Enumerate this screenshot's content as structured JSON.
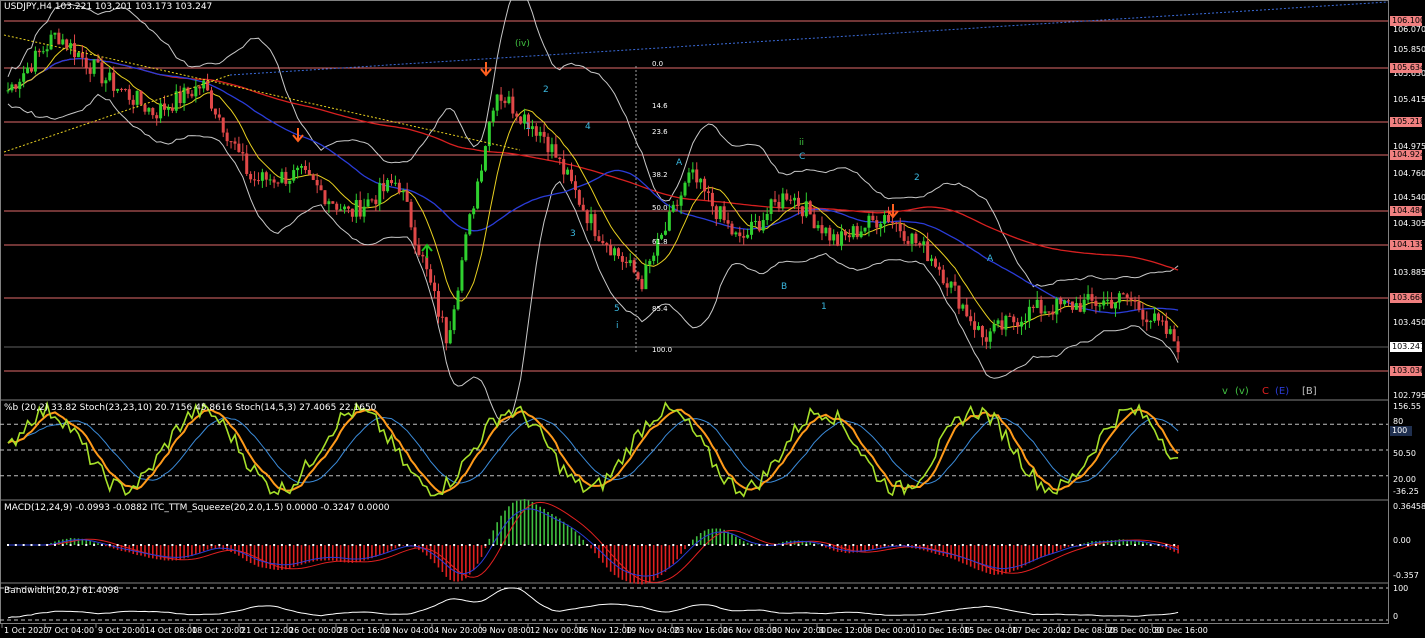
{
  "window": {
    "symbol_line": "USDJPY,H4  103.221 103.201 103.173 103.247",
    "panel2_title": "%b (20,2) 33.82  Stoch(23,23,10) 20.7156 45.8616  Stoch(14,5,3) 27.4065 22.1650",
    "panel3_title": "MACD(12,24,9) -0.0993 -0.0882  ITC_TTM_Squeeze(20,2.0,1.5) 0.0000 -0.3247 0.0000",
    "panel4_title": "Bandwidth(20,2) 61.4098"
  },
  "colors": {
    "background": "#000000",
    "bull": "#2fd02f",
    "bear": "#e04848",
    "level_line": "#e06a6a",
    "level_box": "#f08080",
    "ma_red": "#d82020",
    "ma_blue": "#2a3cd8",
    "ma_yellow": "#e8d020",
    "bands": "#c8c8c8",
    "stoch_green": "#a6e02a",
    "stoch_orange": "#ff9a1a",
    "stoch_blue": "#3a8ad8",
    "macd_green": "#40c040",
    "macd_red": "#e02020",
    "arrow_orange": "#ff6020",
    "arrow_green": "#20c020"
  },
  "price_axis": {
    "ticks": [
      "106.070",
      "105.850",
      "105.630",
      "105.415",
      "104.975",
      "104.760",
      "104.540",
      "104.305",
      "103.885",
      "103.450",
      "102.795"
    ],
    "boxed_levels": [
      "106.100",
      "105.634",
      "105.218",
      "104.924",
      "104.486",
      "104.135",
      "103.668",
      "103.247",
      "103.036"
    ],
    "current": "103.247"
  },
  "panel2_axis": [
    "156.55",
    "80",
    "50.50",
    "20.00",
    "-36.25"
  ],
  "panel2_box": "100",
  "panel3_axis": [
    "0.36458",
    "0.00",
    "-0.357"
  ],
  "panel4_axis": [
    "100",
    "0"
  ],
  "wave_labels": [
    {
      "t": "(iv)",
      "c": "#40c040"
    },
    {
      "t": "2",
      "c": "#3ab8e0"
    },
    {
      "t": "1",
      "c": "#3ab8e0"
    },
    {
      "t": "4",
      "c": "#3ab8e0"
    },
    {
      "t": "3",
      "c": "#3ab8e0"
    },
    {
      "t": "5",
      "c": "#3ab8e0"
    },
    {
      "t": "i",
      "c": "#3ab8e0"
    },
    {
      "t": "A",
      "c": "#3ab8e0"
    },
    {
      "t": "B",
      "c": "#3ab8e0"
    },
    {
      "t": "ii",
      "c": "#40c040"
    },
    {
      "t": "C",
      "c": "#3ab8e0"
    },
    {
      "t": "1",
      "c": "#3ab8e0"
    },
    {
      "t": "2",
      "c": "#3ab8e0"
    },
    {
      "t": "A",
      "c": "#3ab8e0"
    }
  ],
  "fib_labels": [
    "0.0",
    "14.6",
    "23.6",
    "38.2",
    "50.0",
    "61.8",
    "85.4",
    "100.0"
  ],
  "legend": [
    {
      "t": "v",
      "c": "#40c040"
    },
    {
      "t": "(v)",
      "c": "#40c040"
    },
    {
      "t": "C",
      "c": "#e02020"
    },
    {
      "t": "(E)",
      "c": "#2a3cd8"
    },
    {
      "t": "[B]",
      "c": "#c0c0c0"
    }
  ],
  "dates": [
    "1 Oct 2020",
    "7 Oct 04:00",
    "9 Oct 20:00",
    "14 Oct 08:00",
    "18 Oct 20:00",
    "21 Oct 12:00",
    "26 Oct 00:00",
    "28 Oct 16:00",
    "2 Nov 04:00",
    "4 Nov 20:00",
    "9 Nov 08:00",
    "12 Nov 00:00",
    "16 Nov 12:00",
    "19 Nov 04:00",
    "23 Nov 16:00",
    "26 Nov 08:00",
    "30 Nov 20:00",
    "3 Dec 12:00",
    "8 Dec 00:00",
    "10 Dec 16:00",
    "15 Dec 04:00",
    "17 Dec 20:00",
    "22 Dec 08:00",
    "28 Dec 00:00",
    "30 Dec 16:00"
  ],
  "chart_data": {
    "type": "line",
    "title": "USDJPY,H4",
    "xlabel": "",
    "ylabel": "",
    "ylim": [
      102.76,
      106.3
    ],
    "grid": false,
    "series": [
      {
        "name": "price",
        "x": [
          "1 Oct 2020",
          "7 Oct 04:00",
          "9 Oct 20:00",
          "14 Oct 08:00",
          "18 Oct 20:00",
          "21 Oct 12:00",
          "26 Oct 00:00",
          "28 Oct 16:00",
          "2 Nov 04:00",
          "4 Nov 20:00",
          "9 Nov 08:00",
          "12 Nov 00:00",
          "16 Nov 12:00",
          "19 Nov 04:00",
          "23 Nov 16:00",
          "26 Nov 08:00",
          "30 Nov 20:00",
          "3 Dec 12:00",
          "8 Dec 00:00",
          "10 Dec 16:00",
          "15 Dec 04:00",
          "17 Dec 20:00",
          "22 Dec 08:00",
          "28 Dec 00:00",
          "30 Dec 16:00"
        ],
        "values": [
          105.5,
          106.0,
          105.6,
          105.3,
          105.55,
          104.7,
          104.75,
          104.4,
          104.7,
          103.3,
          105.5,
          105.1,
          104.3,
          103.8,
          104.75,
          104.15,
          104.6,
          104.15,
          104.4,
          104.0,
          103.3,
          103.55,
          103.6,
          103.65,
          103.25
        ]
      }
    ]
  }
}
